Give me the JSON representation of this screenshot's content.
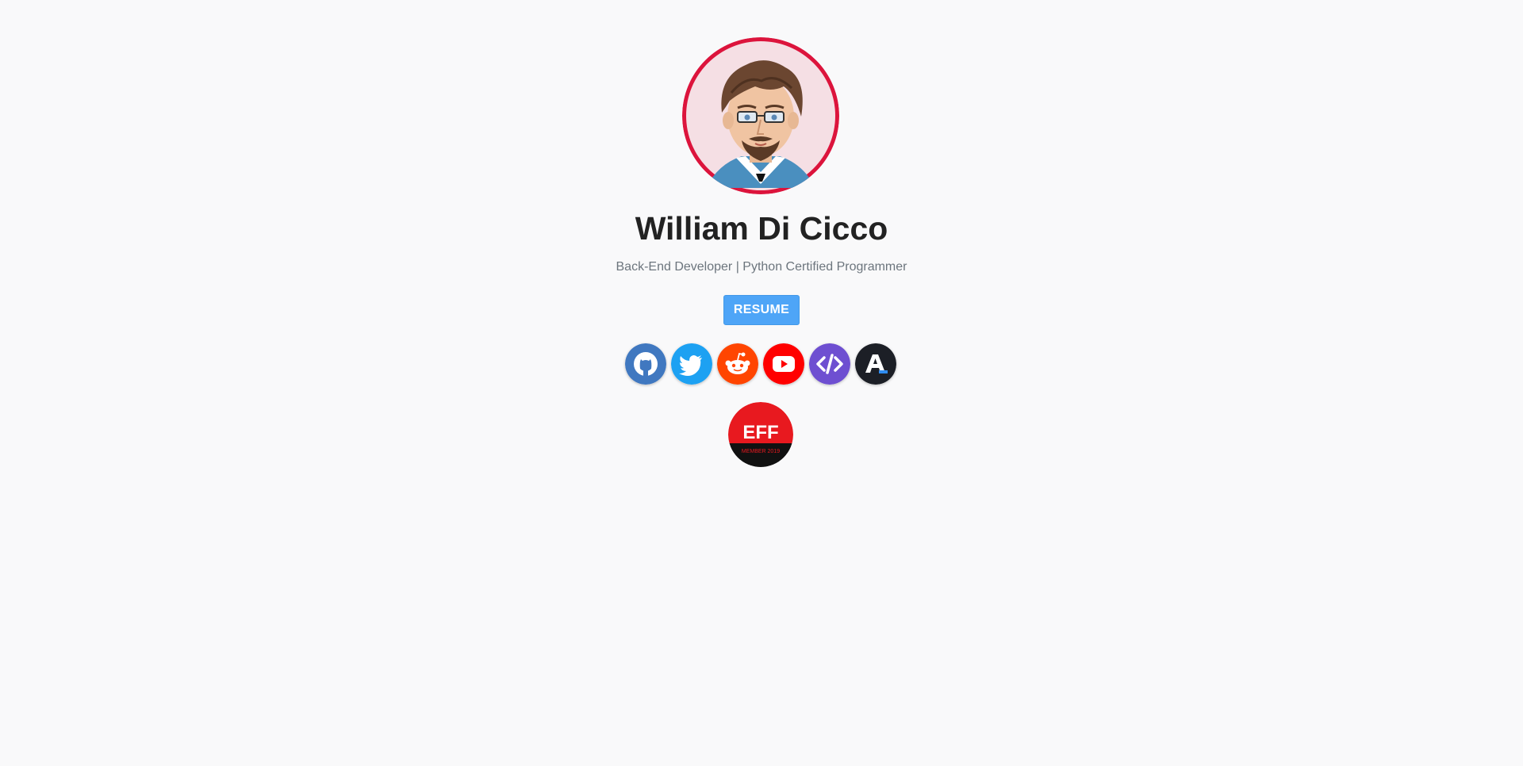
{
  "profile": {
    "name": "William Di Cicco",
    "tagline": "Back-End Developer | Python Certified Programmer",
    "avatar_icon": "cartoon-avatar",
    "avatar_ring_color": "#dc143c"
  },
  "resume_button": {
    "label": "RESUME",
    "color": "#4ea5f7"
  },
  "social_links": [
    {
      "name": "github",
      "icon": "github-icon",
      "color": "#4078c0"
    },
    {
      "name": "twitter",
      "icon": "twitter-icon",
      "color": "#1da1f2"
    },
    {
      "name": "reddit",
      "icon": "reddit-icon",
      "color": "#ff4500"
    },
    {
      "name": "youtube",
      "icon": "youtube-icon",
      "color": "#ff0000"
    },
    {
      "name": "dev-code",
      "icon": "code-icon",
      "color": "#6e4fd1"
    },
    {
      "name": "a-logo",
      "icon": "a-letter-icon",
      "color": "#1c1f26"
    }
  ],
  "eff_badge": {
    "title": "EFF",
    "subtitle": "MEMBER 2019",
    "top_color": "#e8191f",
    "bottom_color": "#111111"
  }
}
